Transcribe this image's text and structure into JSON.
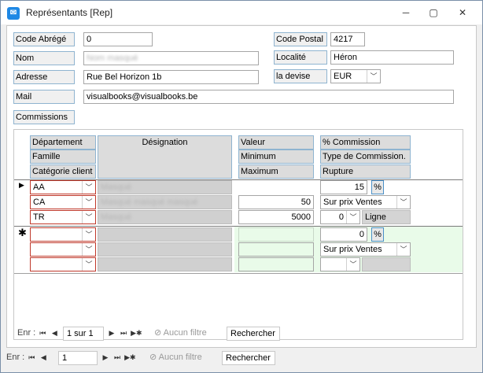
{
  "window": {
    "title": "Représentants [Rep]",
    "icon": "app-icon"
  },
  "form": {
    "code_abrege": {
      "label": "Code Abrégé",
      "value": "0"
    },
    "code_postal": {
      "label": "Code Postal",
      "value": "4217"
    },
    "nom": {
      "label": "Nom",
      "value": "Nom masqué"
    },
    "localite": {
      "label": "Localité",
      "value": "Héron"
    },
    "adresse": {
      "label": "Adresse",
      "value": "Rue Bel Horizon 1b"
    },
    "devise": {
      "label": "la devise",
      "value": "EUR"
    },
    "mail": {
      "label": "Mail",
      "value": "visualbooks@visualbooks.be"
    },
    "commissions_label": "Commissions"
  },
  "subform": {
    "headers": {
      "departement": "Département",
      "famille": "Famille",
      "categorie_client": "Catégorie client",
      "designation": "Désignation",
      "valeur": "Valeur",
      "minimum": "Minimum",
      "maximum": "Maximum",
      "pct_commission": "% Commission",
      "type_commission": "Type de Commission.",
      "rupture": "Rupture"
    },
    "record": {
      "departement": "AA",
      "famille": "CA",
      "categorie": "TR",
      "designation1": "Masqué",
      "designation2": "Masqué masqué masqué",
      "designation3": "Masqué",
      "minimum": "50",
      "maximum": "5000",
      "pct": "15",
      "pct_symbol": "%",
      "type_commission": "Sur prix Ventes",
      "rupture_value": "0",
      "rupture_unit": "Ligne"
    },
    "new_record": {
      "pct": "0",
      "pct_symbol": "%",
      "type_commission": "Sur prix Ventes"
    },
    "nav": {
      "label": "Enr :",
      "position": "1 sur 1",
      "filter": "Aucun filtre",
      "search": "Rechercher"
    }
  },
  "main_nav": {
    "label": "Enr :",
    "position": "1",
    "filter": "Aucun filtre",
    "search": "Rechercher"
  }
}
